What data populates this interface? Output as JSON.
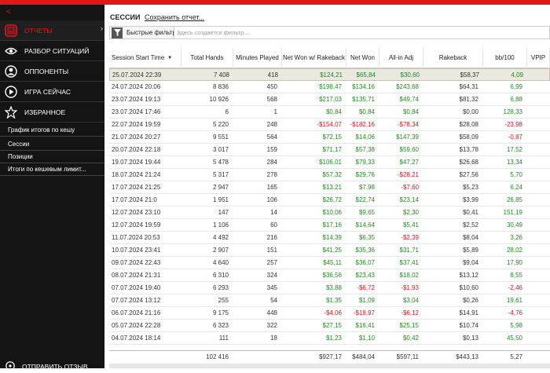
{
  "sidebar": {
    "back": "<",
    "nav": [
      {
        "label": "ОТЧЕТЫ",
        "icon": "reports-icon",
        "active": true
      },
      {
        "label": "РАЗБОР СИТУАЦИЙ",
        "icon": "eye-icon",
        "active": false
      },
      {
        "label": "ОППОНЕНТЫ",
        "icon": "opponent-icon",
        "active": false
      },
      {
        "label": "ИГРА СЕЙЧАС",
        "icon": "play-icon",
        "active": false
      },
      {
        "label": "ИЗБРАННОЕ",
        "icon": "star-icon",
        "active": false
      }
    ],
    "sub": [
      "График итогов по кешу",
      "Сессии",
      "Позиции",
      "Итоги по кешевым лимит..."
    ],
    "feedback": "ОТПРАВИТЬ ОТЗЫВ"
  },
  "main": {
    "title": "СЕССИИ",
    "save": "Сохранить отчет...",
    "filter_label": "Быстрые фильтры",
    "filter_placeholder": "Здесь создается фильтр..."
  },
  "columns": [
    "Session Start Time",
    "Total Hands",
    "Minutes Played",
    "Net Won w/ Rakeback",
    "Net Won",
    "All-in Adj",
    "Rakeback",
    "bb/100",
    "VPIP"
  ],
  "rows": [
    [
      "25.07.2024 22:39",
      "7 408",
      "418",
      "$124,21",
      "$65,84",
      "$30,60",
      "$58,37",
      "4,09"
    ],
    [
      "24.07.2024 20:06",
      "8 836",
      "450",
      "$198,47",
      "$134,16",
      "$243,68",
      "$64,31",
      "6,99"
    ],
    [
      "23.07.2024 19:13",
      "10 926",
      "568",
      "$217,03",
      "$135,71",
      "$49,74",
      "$81,32",
      "6,88"
    ],
    [
      "23.07.2024 17:46",
      "6",
      "1",
      "$0,84",
      "$0,84",
      "$0,84",
      "$0,00",
      "128,33"
    ],
    [
      "22.07.2024 19:59",
      "5 220",
      "248",
      "-$154,07",
      "-$182,16",
      "-$78,34",
      "$28,08",
      "-23,98"
    ],
    [
      "21.07.2024 20:27",
      "9 551",
      "564",
      "$72,15",
      "$14,06",
      "$147,39",
      "$58,09",
      "-0,87"
    ],
    [
      "20.07.2024 22:18",
      "3 017",
      "159",
      "$71,17",
      "$57,38",
      "$59,60",
      "$13,78",
      "17,52"
    ],
    [
      "19.07.2024 19:44",
      "5 478",
      "284",
      "$106,01",
      "$79,33",
      "$47,27",
      "$26,68",
      "13,34"
    ],
    [
      "18.07.2024 21:24",
      "5 317",
      "278",
      "$57,32",
      "$29,76",
      "-$28,21",
      "$27,56",
      "5,70"
    ],
    [
      "17.07.2024 21:25",
      "2 947",
      "165",
      "$13,21",
      "$7,98",
      "-$7,60",
      "$5,23",
      "6,24"
    ],
    [
      "17.07.2024 21:0",
      "1 951",
      "106",
      "$26,72",
      "$22,74",
      "$23,14",
      "$3,99",
      "26,85"
    ],
    [
      "12.07.2024 23:10",
      "147",
      "14",
      "$10,06",
      "$9,65",
      "$2,30",
      "$0,41",
      "151,19"
    ],
    [
      "12.07.2024 19:59",
      "1 106",
      "60",
      "$17,16",
      "$14,64",
      "$5,41",
      "$2,52",
      "30,49"
    ],
    [
      "11.07.2024 20:53",
      "4 492",
      "216",
      "$14,39",
      "$6,35",
      "-$2,39",
      "$8,04",
      "3,26"
    ],
    [
      "10.07.2024 23:41",
      "2 907",
      "151",
      "$41,25",
      "$35,36",
      "$31,71",
      "$5,89",
      "28,02"
    ],
    [
      "09.07.2024 22:43",
      "4 640",
      "257",
      "$45,11",
      "$36,07",
      "$37,41",
      "$9,04",
      "17,90"
    ],
    [
      "08.07.2024 21:31",
      "6 310",
      "324",
      "$36,56",
      "$23,43",
      "$18,02",
      "$13,12",
      "8,55"
    ],
    [
      "07.07.2024 19:40",
      "6 293",
      "345",
      "$3,88",
      "-$6,72",
      "-$1,93",
      "$10,60",
      "-2,46"
    ],
    [
      "07.07.2024 13:12",
      "255",
      "54",
      "$1,35",
      "$1,09",
      "$3,04",
      "$0,26",
      "19,61"
    ],
    [
      "06.07.2024 21:16",
      "9 175",
      "448",
      "-$4,06",
      "-$18,97",
      "-$6,12",
      "$14,91",
      "-4,76"
    ],
    [
      "05.07.2024 22:28",
      "6 323",
      "322",
      "$27,15",
      "$16,41",
      "$25,15",
      "$10,74",
      "5,98"
    ],
    [
      "04.07.2024 18:14",
      "111",
      "18",
      "$1,23",
      "$1,10",
      "$0,42",
      "$0,13",
      "45,50"
    ]
  ],
  "totals": [
    "",
    "102 416",
    "",
    "$927,17",
    "$484,04",
    "$597,11",
    "$443,13",
    "5,27"
  ]
}
